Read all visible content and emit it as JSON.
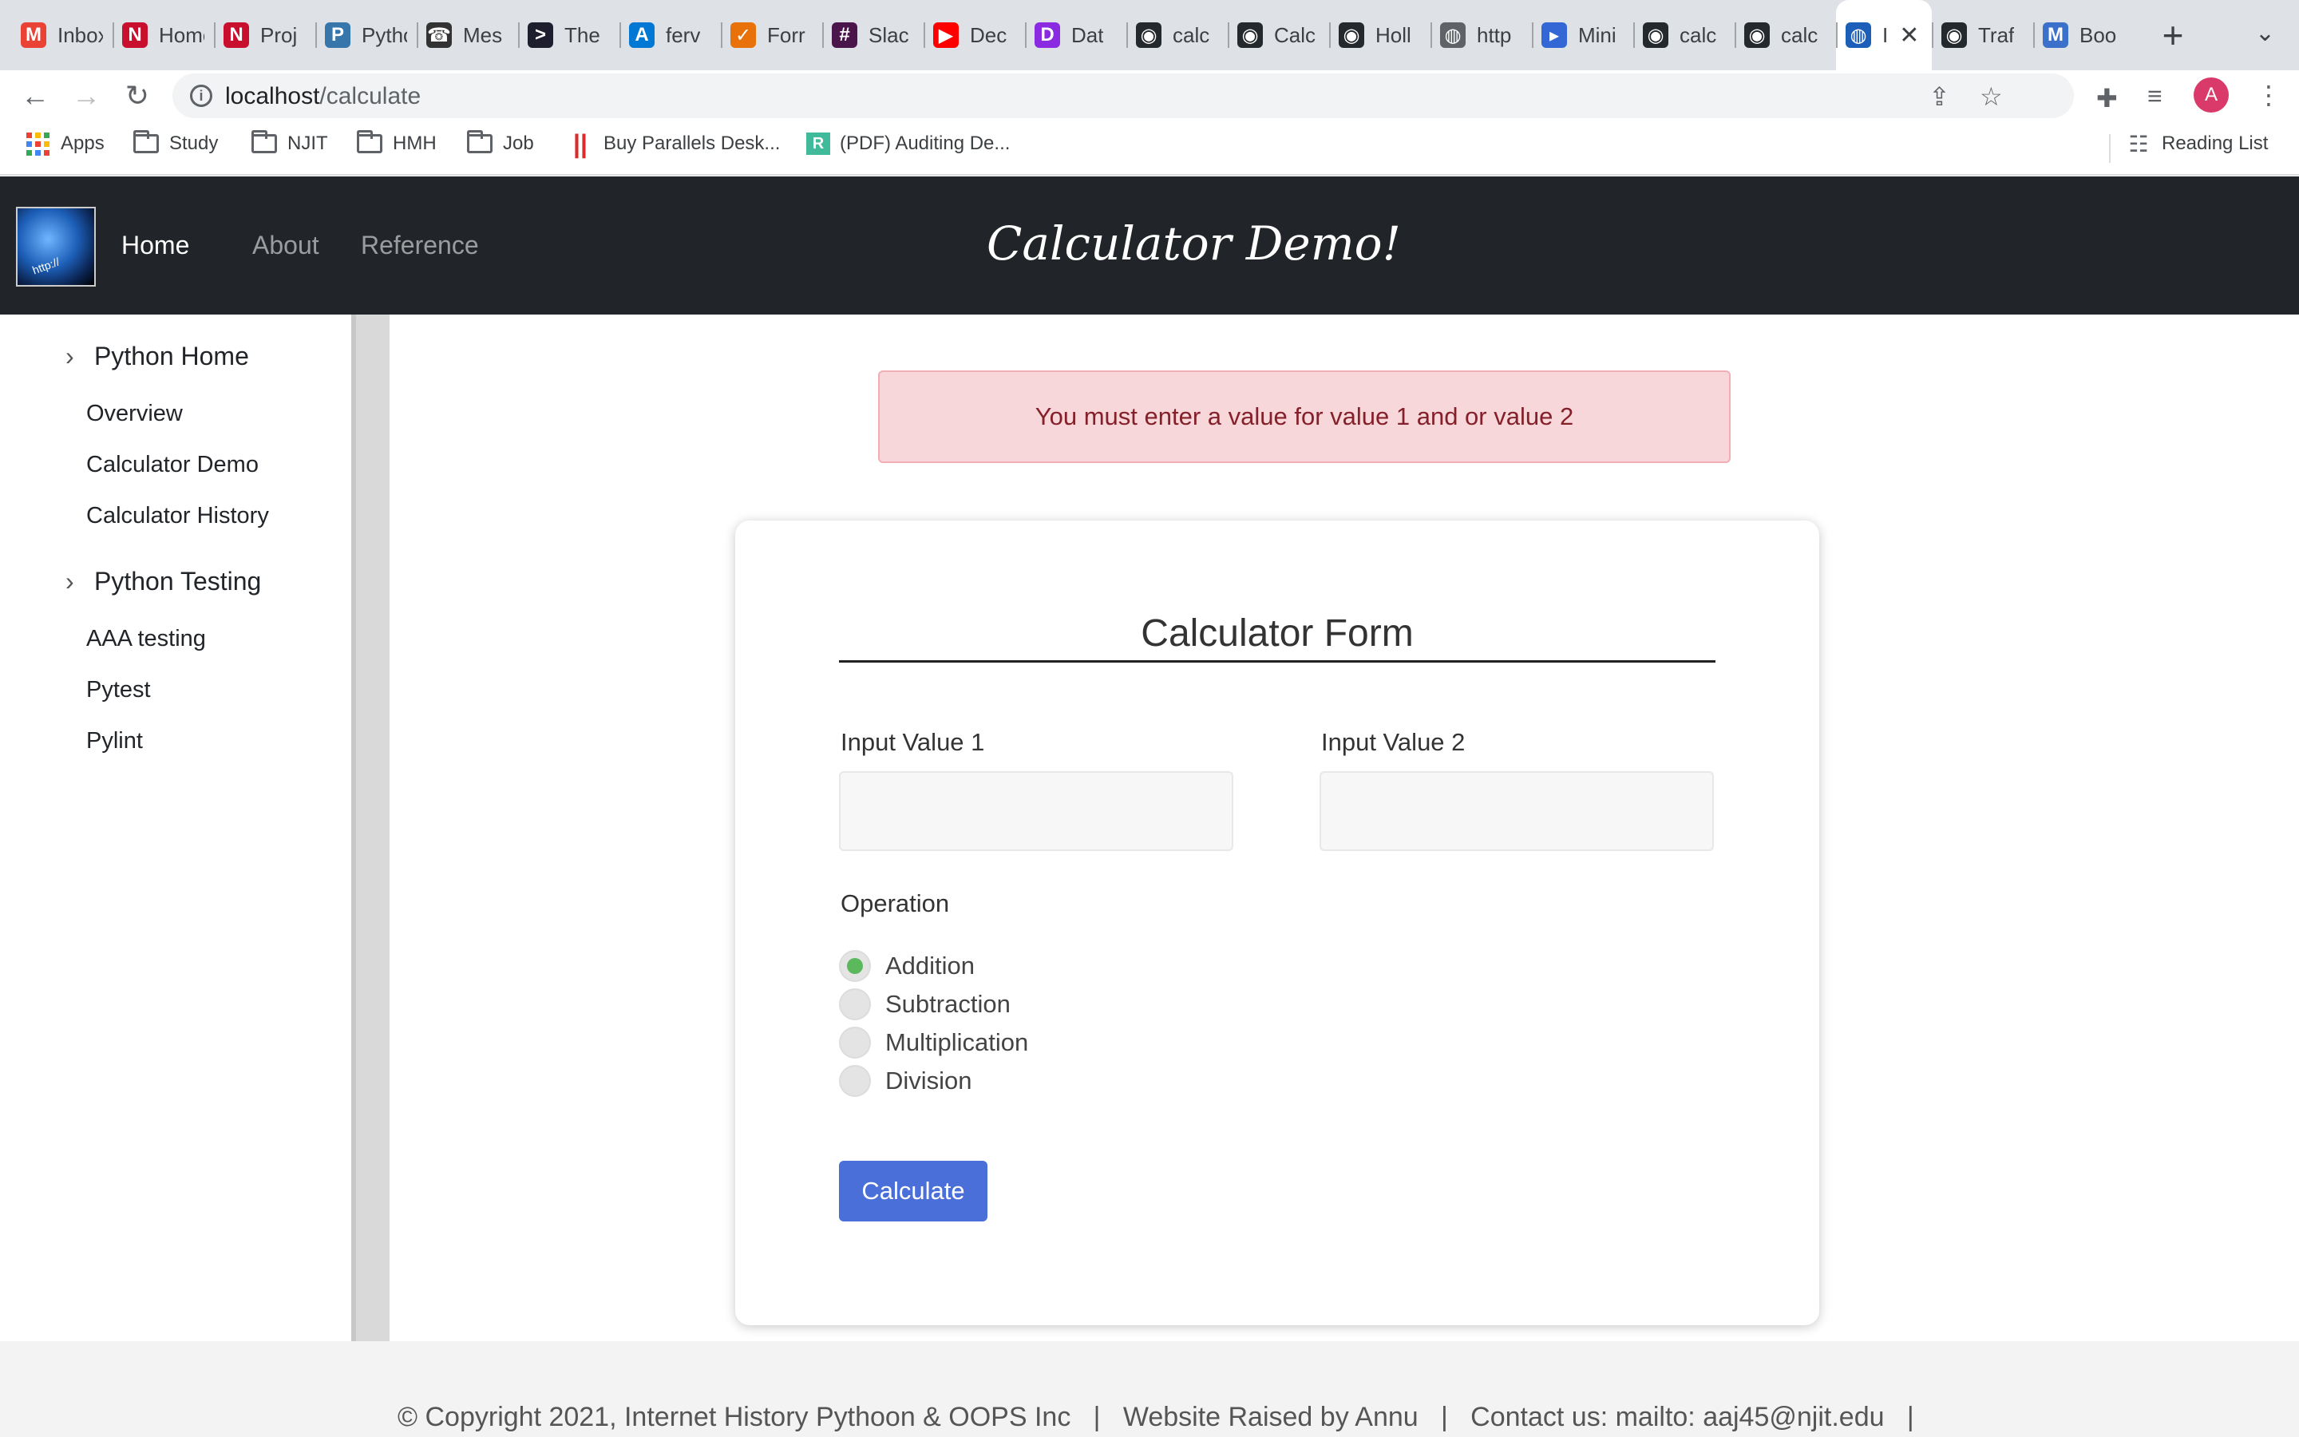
{
  "browser": {
    "tabs": [
      {
        "label": "Inbox",
        "icon": "gmail-icon",
        "color": "#ea4335",
        "glyph": "M"
      },
      {
        "label": "Home",
        "icon": "njit-icon",
        "color": "#c8102e",
        "glyph": "N"
      },
      {
        "label": "Proj",
        "icon": "njit-icon",
        "color": "#c8102e",
        "glyph": "N"
      },
      {
        "label": "Python",
        "icon": "python-icon",
        "color": "#3776ab",
        "glyph": "P"
      },
      {
        "label": "Mes",
        "icon": "phone-icon",
        "color": "#333333",
        "glyph": "☎"
      },
      {
        "label": "The",
        "icon": "terminal-icon",
        "color": "#1e1e2e",
        "glyph": ">"
      },
      {
        "label": "ferv",
        "icon": "azure-icon",
        "color": "#0078d4",
        "glyph": "A"
      },
      {
        "label": "Forr",
        "icon": "forms-icon",
        "color": "#e8710a",
        "glyph": "✓"
      },
      {
        "label": "Slac",
        "icon": "slack-icon",
        "color": "#4a154b",
        "glyph": "#"
      },
      {
        "label": "Dec",
        "icon": "youtube-icon",
        "color": "#ff0000",
        "glyph": "▶"
      },
      {
        "label": "Dat",
        "icon": "datacamp-icon",
        "color": "#8a2be2",
        "glyph": "D"
      },
      {
        "label": "calc",
        "icon": "github-icon",
        "color": "#24292e",
        "glyph": "◉"
      },
      {
        "label": "Calc",
        "icon": "github-icon",
        "color": "#24292e",
        "glyph": "◉"
      },
      {
        "label": "Holl",
        "icon": "github-icon",
        "color": "#24292e",
        "glyph": "◉"
      },
      {
        "label": "http",
        "icon": "globe-icon",
        "color": "#5f6368",
        "glyph": "◍"
      },
      {
        "label": "Mini",
        "icon": "mini-icon",
        "color": "#3367d6",
        "glyph": "▸"
      },
      {
        "label": "calc",
        "icon": "github-icon",
        "color": "#24292e",
        "glyph": "◉"
      },
      {
        "label": "calc",
        "icon": "github-icon",
        "color": "#24292e",
        "glyph": "◉"
      },
      {
        "label": "I",
        "icon": "earth-icon",
        "color": "#1d5fb8",
        "glyph": "◍",
        "active": true
      },
      {
        "label": "Traf",
        "icon": "github-icon",
        "color": "#24292e",
        "glyph": "◉"
      },
      {
        "label": "Boo",
        "icon": "mdb-icon",
        "color": "#3b71ca",
        "glyph": "M"
      }
    ],
    "url_host": "localhost",
    "url_path": "/calculate",
    "bookmarks": [
      {
        "label": "Apps"
      },
      {
        "label": "Study"
      },
      {
        "label": "NJIT"
      },
      {
        "label": "HMH"
      },
      {
        "label": "Job"
      },
      {
        "label": "Buy Parallels Desk..."
      },
      {
        "label": "(PDF) Auditing De..."
      }
    ],
    "reading_list": "Reading List",
    "profile_initial": "A"
  },
  "nav": {
    "home": "Home",
    "about": "About",
    "reference": "Reference",
    "title": "Calculator Demo!",
    "logo_text": "http://"
  },
  "sidebar": {
    "sections": [
      {
        "heading": "Python Home",
        "items": [
          "Overview",
          "Calculator Demo",
          "Calculator History"
        ]
      },
      {
        "heading": "Python Testing",
        "items": [
          "AAA testing",
          "Pytest",
          "Pylint"
        ]
      }
    ]
  },
  "alert": {
    "message": "You must enter a value for value 1 and or value 2"
  },
  "form": {
    "title": "Calculator Form",
    "value1_label": "Input Value 1",
    "value1": "",
    "value2_label": "Input Value 2",
    "value2": "",
    "operation_label": "Operation",
    "operations": [
      "Addition",
      "Subtraction",
      "Multiplication",
      "Division"
    ],
    "selected_operation": "Addition",
    "submit_label": "Calculate"
  },
  "footer": {
    "text": "© Copyright 2021, Internet History Pythoon & OOPS Inc   |   Website Raised by Annu   |   Contact us: mailto: aaj45@njit.edu   |"
  }
}
